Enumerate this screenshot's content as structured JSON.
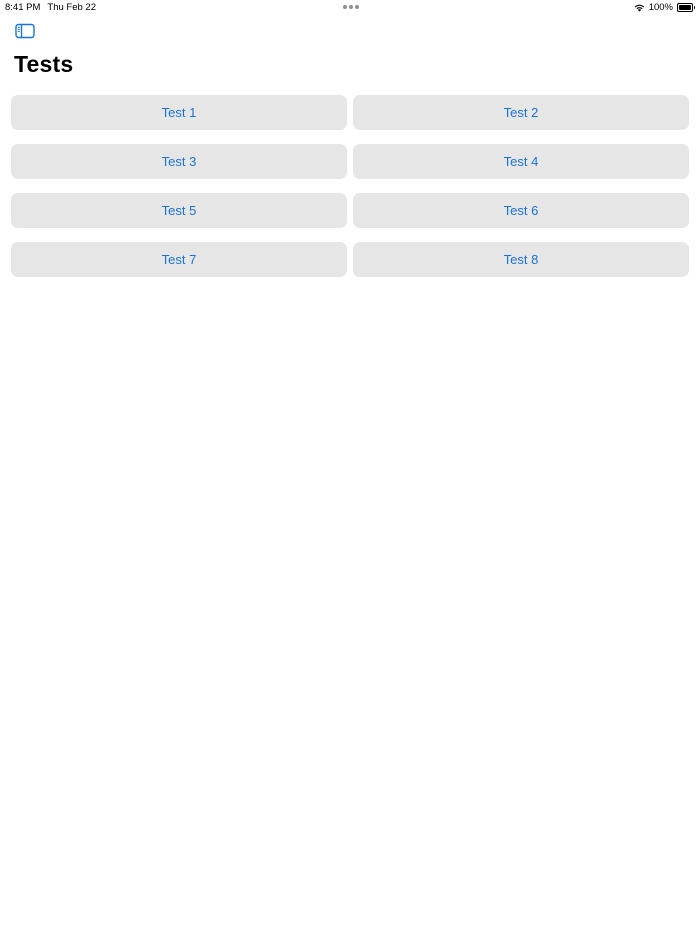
{
  "status_bar": {
    "time": "8:41 PM",
    "date": "Thu Feb 22",
    "battery": "100%",
    "battery_level": 1.0
  },
  "toolbar": {
    "sidebar_icon": "sidebar-left-icon"
  },
  "page": {
    "title": "Tests"
  },
  "buttons": [
    {
      "label": "Test 1"
    },
    {
      "label": "Test 2"
    },
    {
      "label": "Test 3"
    },
    {
      "label": "Test 4"
    },
    {
      "label": "Test 5"
    },
    {
      "label": "Test 6"
    },
    {
      "label": "Test 7"
    },
    {
      "label": "Test 8"
    }
  ],
  "colors": {
    "accent": "#1a73d9",
    "button_bg": "#e6e6e6",
    "background": "#ffffff"
  }
}
